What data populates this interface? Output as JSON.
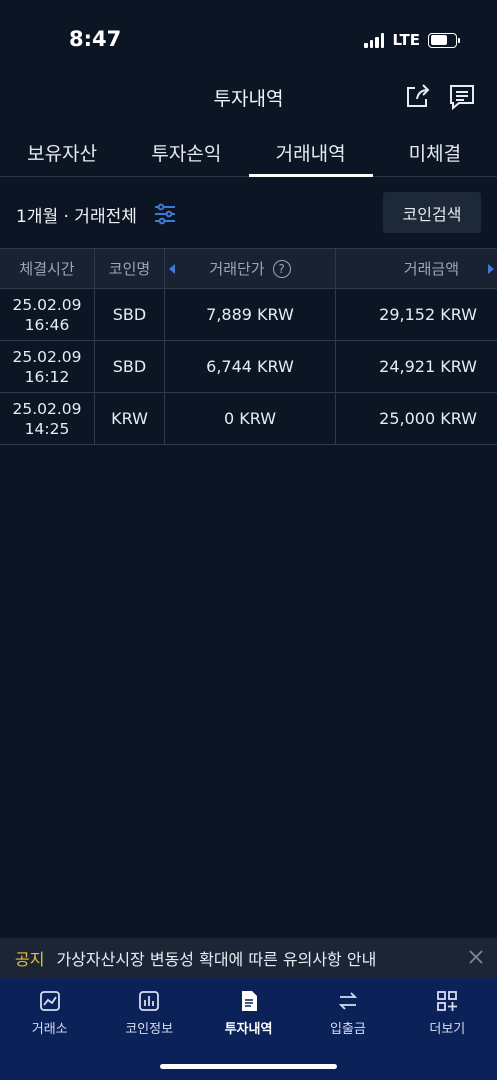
{
  "status": {
    "time": "8:47",
    "network": "LTE"
  },
  "header": {
    "title": "투자내역"
  },
  "tabs": [
    {
      "label": "보유자산",
      "active": false
    },
    {
      "label": "투자손익",
      "active": false
    },
    {
      "label": "거래내역",
      "active": true
    },
    {
      "label": "미체결",
      "active": false
    }
  ],
  "filter": {
    "text": "1개월 · 거래전체",
    "search_button": "코인검색"
  },
  "table": {
    "headers": [
      "체결시간",
      "코인명",
      "거래단가",
      "거래금액"
    ],
    "rows": [
      {
        "date": "25.02.09",
        "time": "16:46",
        "coin": "SBD",
        "price": "7,889 KRW",
        "amount": "29,152 KRW"
      },
      {
        "date": "25.02.09",
        "time": "16:12",
        "coin": "SBD",
        "price": "6,744 KRW",
        "amount": "24,921 KRW"
      },
      {
        "date": "25.02.09",
        "time": "14:25",
        "coin": "KRW",
        "price": "0 KRW",
        "amount": "25,000 KRW"
      }
    ]
  },
  "notice": {
    "tag": "공지",
    "text": "가상자산시장 변동성 확대에 따른 유의사항 안내"
  },
  "bottom_nav": [
    {
      "label": "거래소",
      "icon": "chart-icon"
    },
    {
      "label": "코인정보",
      "icon": "bar-chart-icon"
    },
    {
      "label": "투자내역",
      "icon": "document-icon",
      "active": true
    },
    {
      "label": "입출금",
      "icon": "transfer-icon"
    },
    {
      "label": "더보기",
      "icon": "grid-plus-icon"
    }
  ],
  "colors": {
    "background": "#0b1523",
    "nav_background": "#0b2259",
    "notice_tag": "#e8c13a",
    "accent": "#3f7ad8"
  }
}
